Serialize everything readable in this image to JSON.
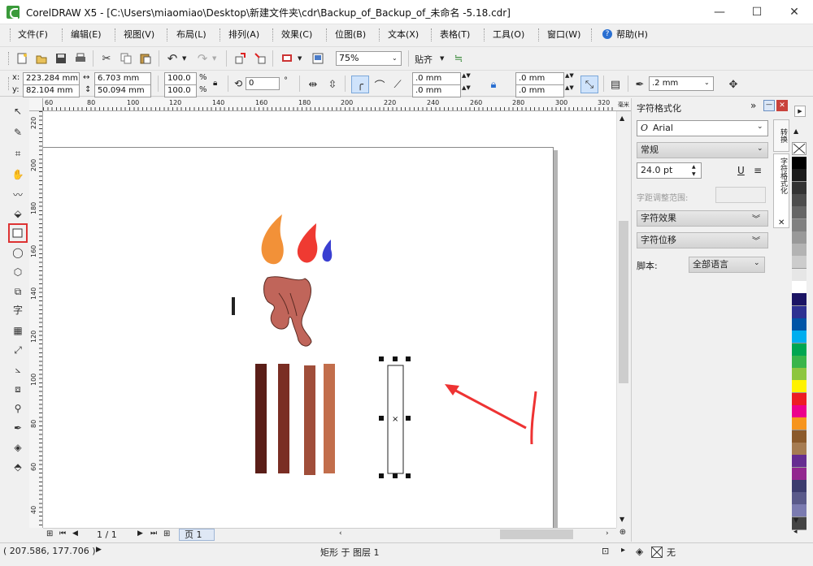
{
  "window": {
    "title": "CorelDRAW X5 - [C:\\Users\\miaomiao\\Desktop\\新建文件夹\\cdr\\Backup_of_Backup_of_未命名 -5.18.cdr]",
    "minimize": "—",
    "maximize": "☐",
    "close": "✕"
  },
  "menu": {
    "items": [
      "文件(F)",
      "编辑(E)",
      "视图(V)",
      "布局(L)",
      "排列(A)",
      "效果(C)",
      "位图(B)",
      "文本(X)",
      "表格(T)",
      "工具(O)",
      "窗口(W)",
      "帮助(H)"
    ]
  },
  "toolbar": {
    "zoom": "75%",
    "snap": "贴齐"
  },
  "property_bar": {
    "x": "223.284 mm",
    "y": "82.104 mm",
    "width": "6.703 mm",
    "height": "50.094 mm",
    "scale_x": "100.0",
    "scale_y": "100.0",
    "percent": "%",
    "rotation": "0",
    "deg": "°",
    "corner1": ".0 mm",
    "corner2": ".0 mm",
    "corner3": ".0 mm",
    "corner4": ".0 mm",
    "outline": ".2 mm"
  },
  "rulers": {
    "top": [
      "60",
      "80",
      "100",
      "120",
      "140",
      "160",
      "180",
      "200",
      "220",
      "240",
      "260",
      "280",
      "300",
      "320"
    ],
    "top_unit": "毫米",
    "left": [
      "220",
      "200",
      "180",
      "160",
      "140",
      "120",
      "100",
      "80",
      "60",
      "40"
    ]
  },
  "docker": {
    "title": "字符格式化",
    "font": "Arial",
    "style": "常规",
    "size": "24.0 pt",
    "kerning_label": "字距调整范围:",
    "effects": "字符效果",
    "offset": "字符位移",
    "script_label": "脚本:",
    "script_value": "全部语言",
    "side_tabs": [
      "转换",
      "字符格式化"
    ]
  },
  "palette": {
    "colors": [
      "#000000",
      "#1a1a1a",
      "#333333",
      "#4d4d4d",
      "#666666",
      "#808080",
      "#999999",
      "#b3b3b3",
      "#cccccc",
      "#e6e6e6",
      "#ffffff",
      "#1b1464",
      "#2e3192",
      "#0054a6",
      "#00aeef",
      "#00a651",
      "#39b54a",
      "#8dc63f",
      "#fff200",
      "#ed1c24",
      "#ec008c",
      "#f7941d",
      "#8b5a2b",
      "#a67c52",
      "#662d91",
      "#92278f",
      "#3c3c6e",
      "#5a5a8a",
      "#7b7bb0",
      "#444444"
    ]
  },
  "page_nav": {
    "count": "1 / 1",
    "page_tab": "页 1"
  },
  "status": {
    "coords": "( 207.586, 177.706 )",
    "info": "矩形 于 图层 1",
    "fill": "无"
  }
}
